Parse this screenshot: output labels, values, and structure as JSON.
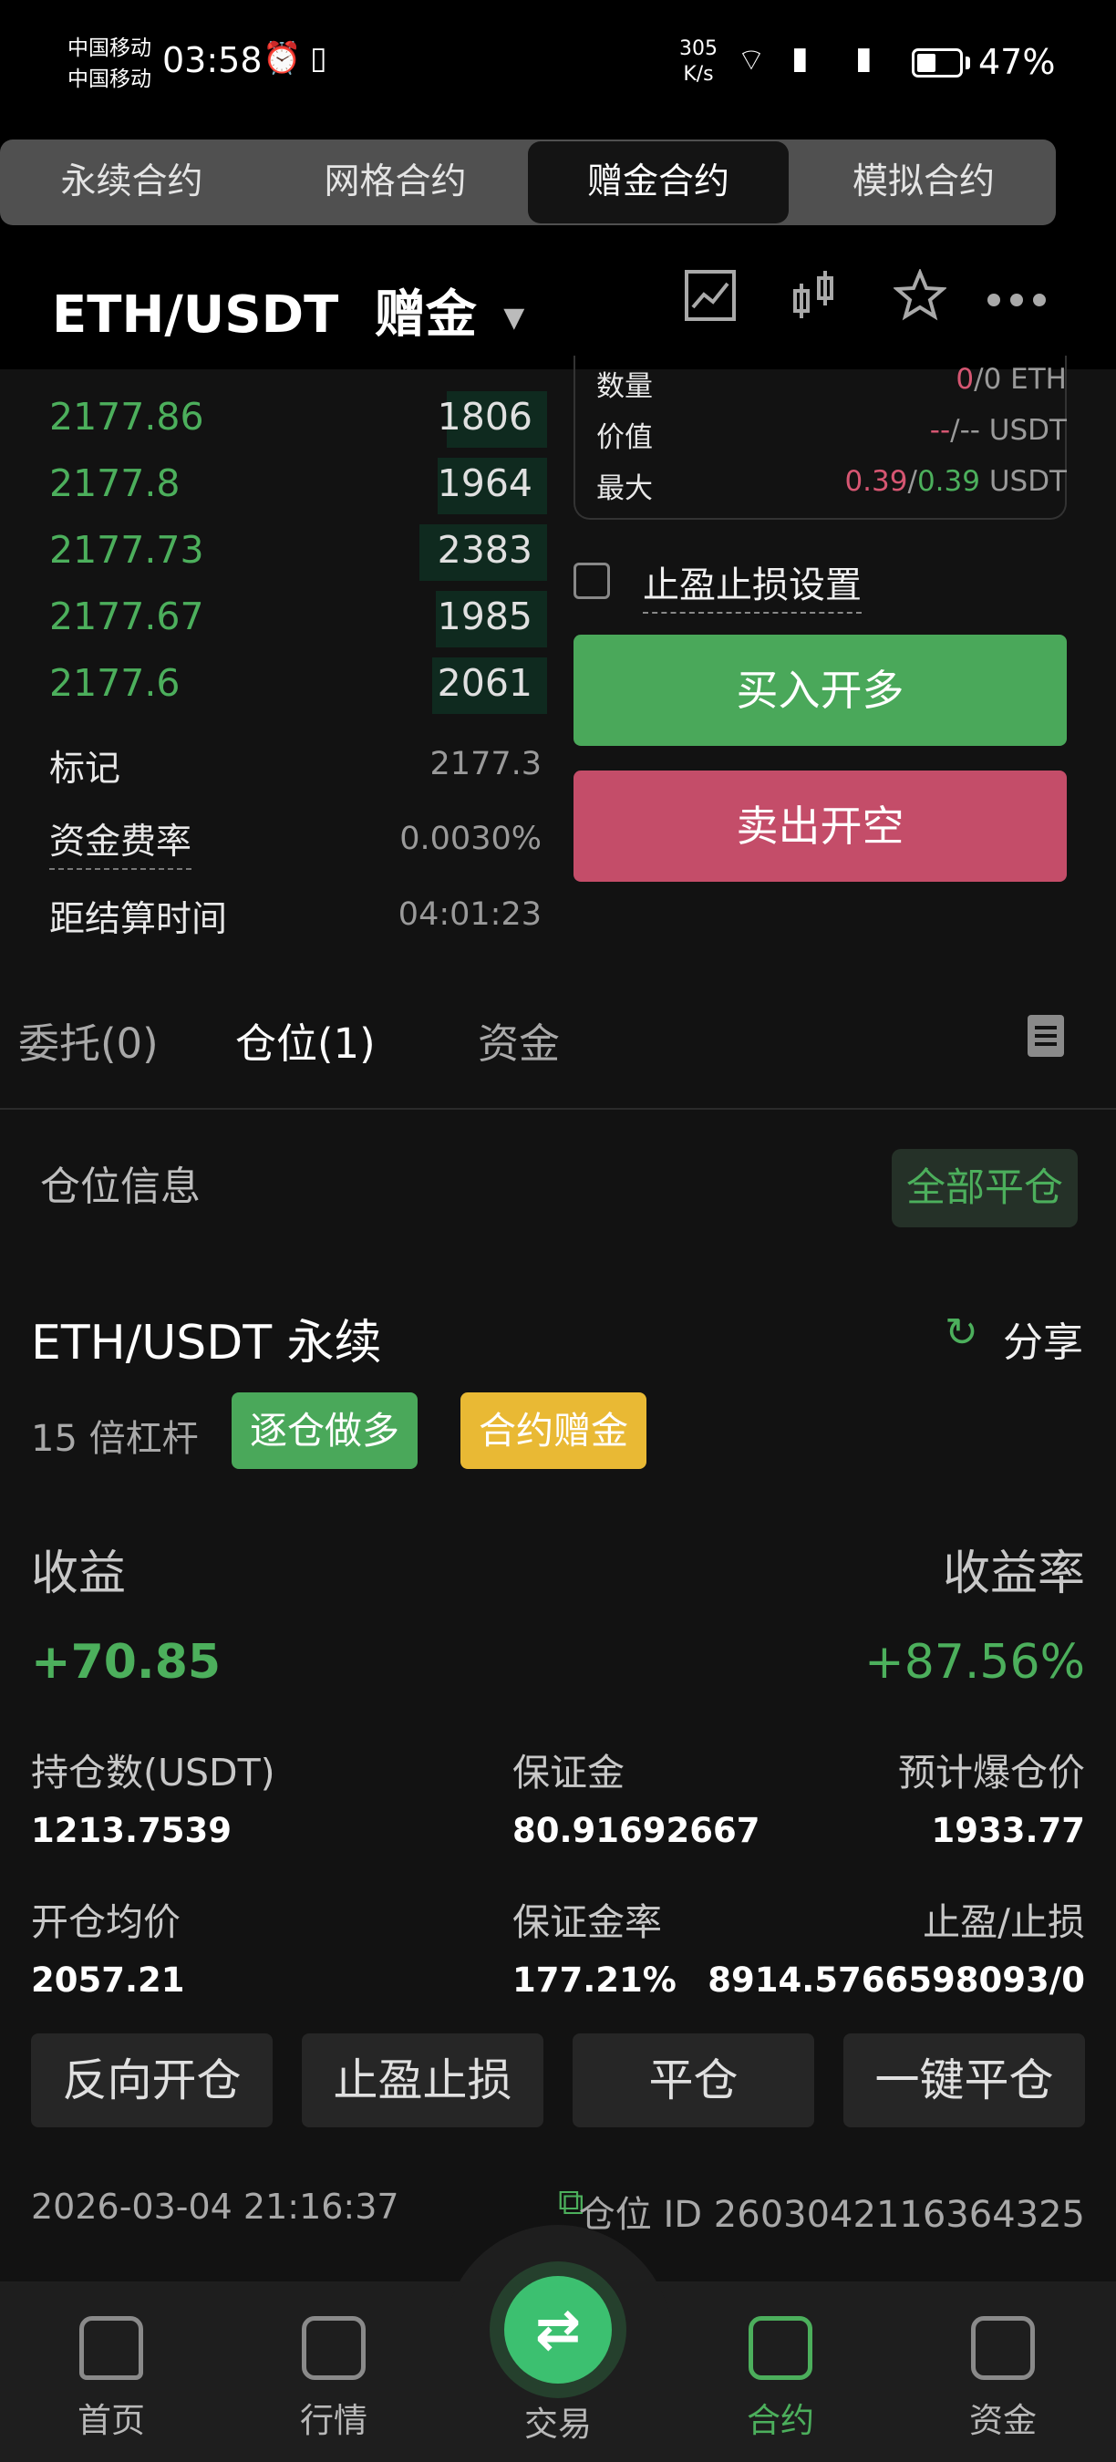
{
  "status_bar": {
    "carrier1": "中国移动",
    "carrier2": "中国移动",
    "time": "03:58",
    "net_speed": "305",
    "net_unit": "K/s",
    "battery": "47%"
  },
  "top_tabs": [
    "永续合约",
    "网格合约",
    "赠金合约",
    "模拟合约"
  ],
  "header": {
    "pair": "ETH/USDT",
    "mode": "赠金",
    "icons": [
      "chart-line-icon",
      "candlestick-icon",
      "star-icon",
      "more-icon"
    ]
  },
  "orderbook": [
    {
      "price": "2177.86",
      "qty": "1806"
    },
    {
      "price": "2177.8",
      "qty": "1964"
    },
    {
      "price": "2177.73",
      "qty": "2383"
    },
    {
      "price": "2177.67",
      "qty": "1985"
    },
    {
      "price": "2177.6",
      "qty": "2061"
    }
  ],
  "market_info": {
    "mark_label": "标记",
    "mark_value": "2177.3",
    "funding_label": "资金费率",
    "funding_value": "0.0030%",
    "settle_label": "距结算时间",
    "settle_value": "04:01:23"
  },
  "order_form": {
    "qty_label": "数量",
    "qty_left": "0",
    "qty_right": "/0 ETH",
    "value_label": "价值",
    "value_left": "--",
    "value_right": "/-- USDT",
    "max_label": "最大",
    "max_left": "0.39",
    "max_sep": "/",
    "max_mid": "0.39",
    "max_unit": " USDT",
    "tpsl_label": "止盈止损设置",
    "buy_label": "买入开多",
    "sell_label": "卖出开空"
  },
  "sub_tabs": {
    "orders": "委托(0)",
    "positions": "仓位(1)",
    "funds": "资金"
  },
  "position": {
    "section_title": "仓位信息",
    "close_all": "全部平仓",
    "pair": "ETH/USDT 永续",
    "share": "分享",
    "leverage": "15 倍杠杆",
    "tag_side": "逐仓做多",
    "tag_bonus": "合约赠金",
    "pnl_label": "收益",
    "pnl_value": "+70.85",
    "roe_label": "收益率",
    "roe_value": "+87.56%",
    "size_label": "持仓数(USDT)",
    "size_value": "1213.7539",
    "margin_label": "保证金",
    "margin_value": "80.91692667",
    "liq_label": "预计爆仓价",
    "liq_value": "1933.77",
    "entry_label": "开仓均价",
    "entry_value": "2057.21",
    "margin_ratio_label": "保证金率",
    "margin_ratio_value": "177.21%",
    "tpsl_label": "止盈/止损",
    "tpsl_value": "8914.5766598093/0",
    "buttons": [
      "反向开仓",
      "止盈止损",
      "平仓",
      "一键平仓"
    ],
    "timestamp": "2026-03-04 21:16:37",
    "position_id": "仓位 ID 2603042116364325"
  },
  "bottom_nav": [
    "首页",
    "行情",
    "交易",
    "合约",
    "资金"
  ],
  "colors": {
    "green": "#4caf5c",
    "red": "#c44d69",
    "yellow": "#e9b934"
  }
}
